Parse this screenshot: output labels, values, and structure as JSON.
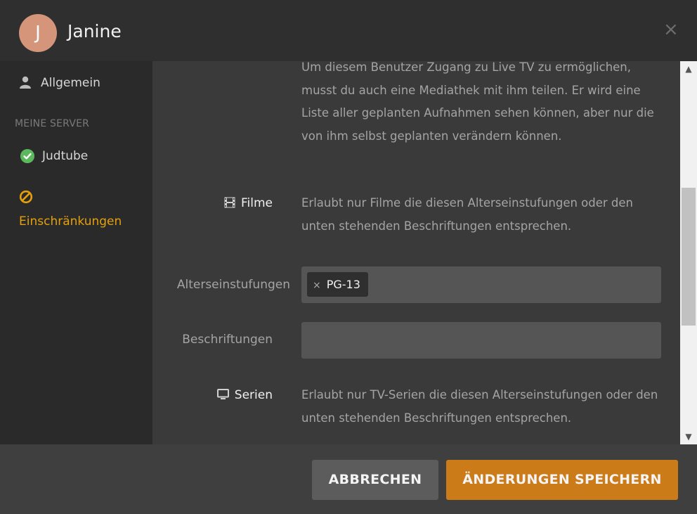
{
  "header": {
    "avatar_initial": "J",
    "title": "Janine",
    "close_label": "×"
  },
  "sidebar": {
    "general_label": "Allgemein",
    "section_title": "MEINE SERVER",
    "server_label": "Judtube",
    "restrictions_label": "Einschränkungen"
  },
  "content": {
    "live_tv_text": "Um diesem Benutzer Zugang zu Live TV zu ermöglichen, musst du auch eine Mediathek mit ihm teilen. Er wird eine Liste aller geplanten Aufnahmen sehen können, aber nur die von ihm selbst geplanten verändern können.",
    "movies": {
      "label": "Filme",
      "text": "Erlaubt nur Filme die diesen Alterseinstufungen oder den unten stehenden Beschriftungen entsprechen.",
      "ratings_label": "Alterseinstufungen",
      "rating_tag": "PG-13",
      "tag_remove": "×",
      "labels_label": "Beschriftungen"
    },
    "shows": {
      "label": "Serien",
      "text": "Erlaubt nur TV-Serien die diesen Alterseinstufungen oder den unten stehenden Beschriftungen entsprechen."
    }
  },
  "scrollbar": {
    "up": "▲",
    "down": "▼"
  },
  "footer": {
    "cancel_label": "ABBRECHEN",
    "save_label": "ÄNDERUNGEN SPEICHERN"
  },
  "colors": {
    "accent": "#e5a00d",
    "save_button": "#cc7b19",
    "check": "#5cb85c",
    "avatar": "#d4957b"
  }
}
